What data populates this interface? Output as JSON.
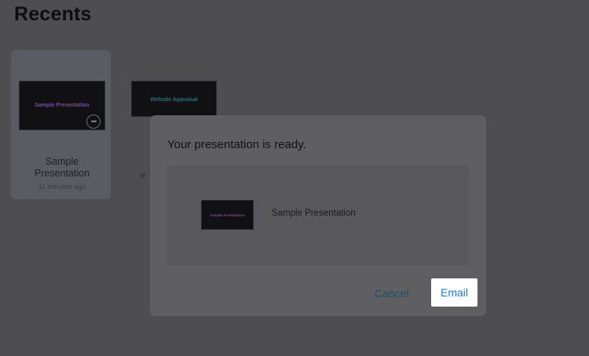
{
  "page": {
    "title": "Recents"
  },
  "recents": {
    "item1": {
      "thumb_text": "Sample Presentation",
      "name": "Sample Presentation",
      "time": "11 minutes ago",
      "more_symbol": "•••"
    },
    "item2": {
      "thumb_text": "Website Appraisal",
      "partial_text": "e"
    }
  },
  "dialog": {
    "title": "Your presentation is ready.",
    "preview": {
      "thumb_text": "Sample Presentation",
      "name": "Sample Presentation"
    },
    "cancel_label": "Cancel",
    "email_label": "Email"
  }
}
